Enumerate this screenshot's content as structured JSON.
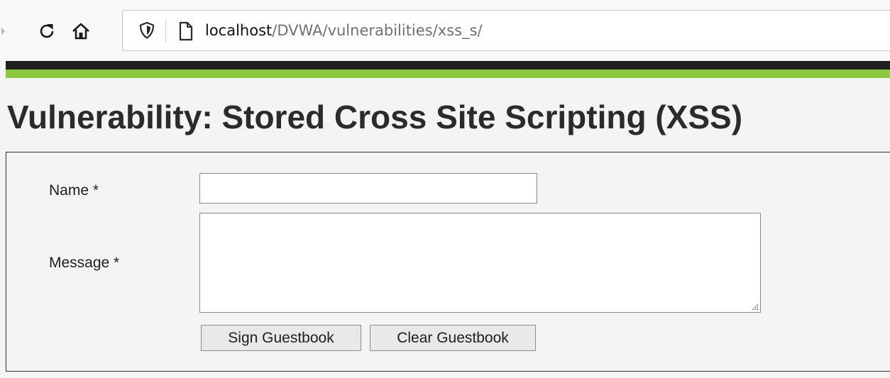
{
  "browser": {
    "url_host": "localhost",
    "url_path": "/DVWA/vulnerabilities/xss_s/",
    "icons": [
      "back-arrow-icon",
      "reload-icon",
      "home-icon",
      "tracking-shield-icon",
      "page-icon"
    ]
  },
  "theme": {
    "header_dark": "#1f1f1f",
    "header_accent": "#8dc63f"
  },
  "page": {
    "title": "Vulnerability: Stored Cross Site Scripting (XSS)"
  },
  "form": {
    "name_label": "Name *",
    "name_value": "",
    "message_label": "Message *",
    "message_value": "",
    "sign_button": "Sign Guestbook",
    "clear_button": "Clear Guestbook"
  }
}
